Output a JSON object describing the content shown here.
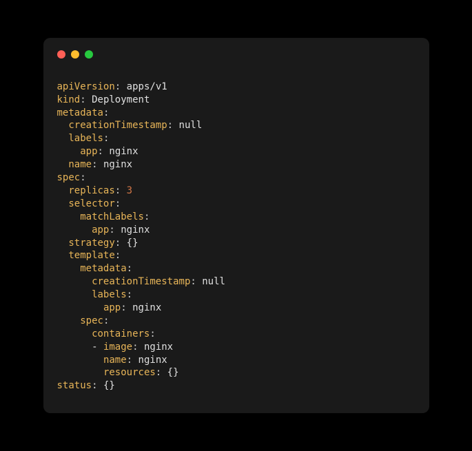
{
  "titlebar": {
    "buttons": [
      "close",
      "minimize",
      "zoom"
    ]
  },
  "yaml": {
    "lines": [
      {
        "indent": 0,
        "key": "apiVersion",
        "value": "apps/v1",
        "valueType": "string"
      },
      {
        "indent": 0,
        "key": "kind",
        "value": "Deployment",
        "valueType": "string"
      },
      {
        "indent": 0,
        "key": "metadata",
        "value": "",
        "valueType": "none"
      },
      {
        "indent": 1,
        "key": "creationTimestamp",
        "value": "null",
        "valueType": "null"
      },
      {
        "indent": 1,
        "key": "labels",
        "value": "",
        "valueType": "none"
      },
      {
        "indent": 2,
        "key": "app",
        "value": "nginx",
        "valueType": "string"
      },
      {
        "indent": 1,
        "key": "name",
        "value": "nginx",
        "valueType": "string"
      },
      {
        "indent": 0,
        "key": "spec",
        "value": "",
        "valueType": "none"
      },
      {
        "indent": 1,
        "key": "replicas",
        "value": "3",
        "valueType": "number"
      },
      {
        "indent": 1,
        "key": "selector",
        "value": "",
        "valueType": "none"
      },
      {
        "indent": 2,
        "key": "matchLabels",
        "value": "",
        "valueType": "none"
      },
      {
        "indent": 3,
        "key": "app",
        "value": "nginx",
        "valueType": "string"
      },
      {
        "indent": 1,
        "key": "strategy",
        "value": "{}",
        "valueType": "brace"
      },
      {
        "indent": 1,
        "key": "template",
        "value": "",
        "valueType": "none"
      },
      {
        "indent": 2,
        "key": "metadata",
        "value": "",
        "valueType": "none"
      },
      {
        "indent": 3,
        "key": "creationTimestamp",
        "value": "null",
        "valueType": "null"
      },
      {
        "indent": 3,
        "key": "labels",
        "value": "",
        "valueType": "none"
      },
      {
        "indent": 4,
        "key": "app",
        "value": "nginx",
        "valueType": "string"
      },
      {
        "indent": 2,
        "key": "spec",
        "value": "",
        "valueType": "none"
      },
      {
        "indent": 3,
        "key": "containers",
        "value": "",
        "valueType": "none"
      },
      {
        "indent": 3,
        "dash": true,
        "key": "image",
        "value": "nginx",
        "valueType": "string"
      },
      {
        "indent": 4,
        "key": "name",
        "value": "nginx",
        "valueType": "string"
      },
      {
        "indent": 4,
        "key": "resources",
        "value": "{}",
        "valueType": "brace"
      },
      {
        "indent": 0,
        "key": "status",
        "value": "{}",
        "valueType": "brace"
      }
    ]
  }
}
